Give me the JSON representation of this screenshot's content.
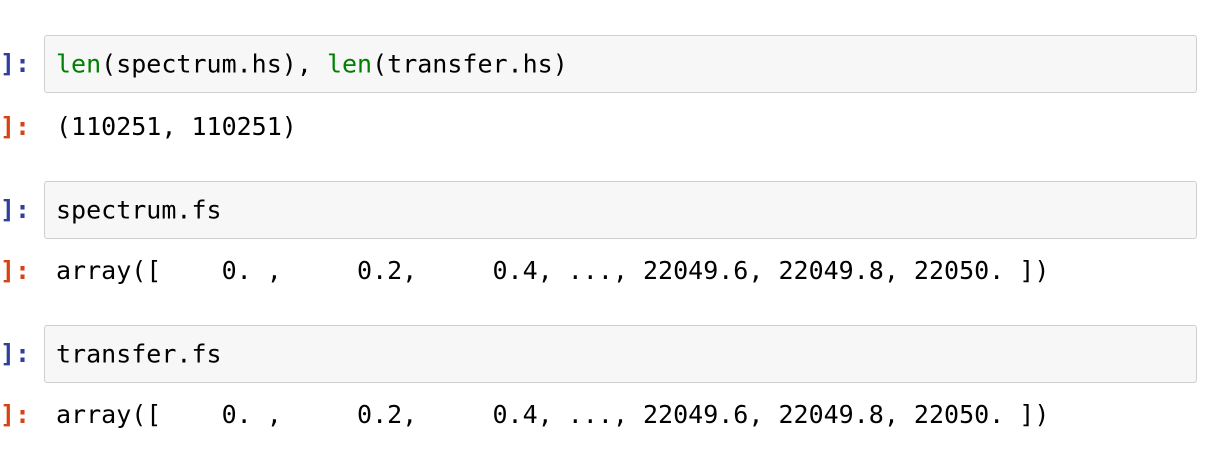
{
  "cells": [
    {
      "in_prompt": "]:",
      "code": {
        "fn1": "len",
        "arg1": "(spectrum.hs), ",
        "fn2": "len",
        "arg2": "(transfer.hs)"
      },
      "out_prompt": "]:",
      "output": "(110251, 110251)"
    },
    {
      "in_prompt": "]:",
      "code": {
        "text": "spectrum.fs"
      },
      "out_prompt": "]:",
      "output": "array([    0. ,     0.2,     0.4, ..., 22049.6, 22049.8, 22050. ])"
    },
    {
      "in_prompt": "]:",
      "code": {
        "text": "transfer.fs"
      },
      "out_prompt": "]:",
      "output": "array([    0. ,     0.2,     0.4, ..., 22049.6, 22049.8, 22050. ])"
    }
  ],
  "colors": {
    "in_prompt": "#303f9f",
    "out_prompt": "#d84315",
    "builtin": "#008000",
    "input_bg": "#f7f7f7",
    "input_border": "#cfcfcf"
  }
}
